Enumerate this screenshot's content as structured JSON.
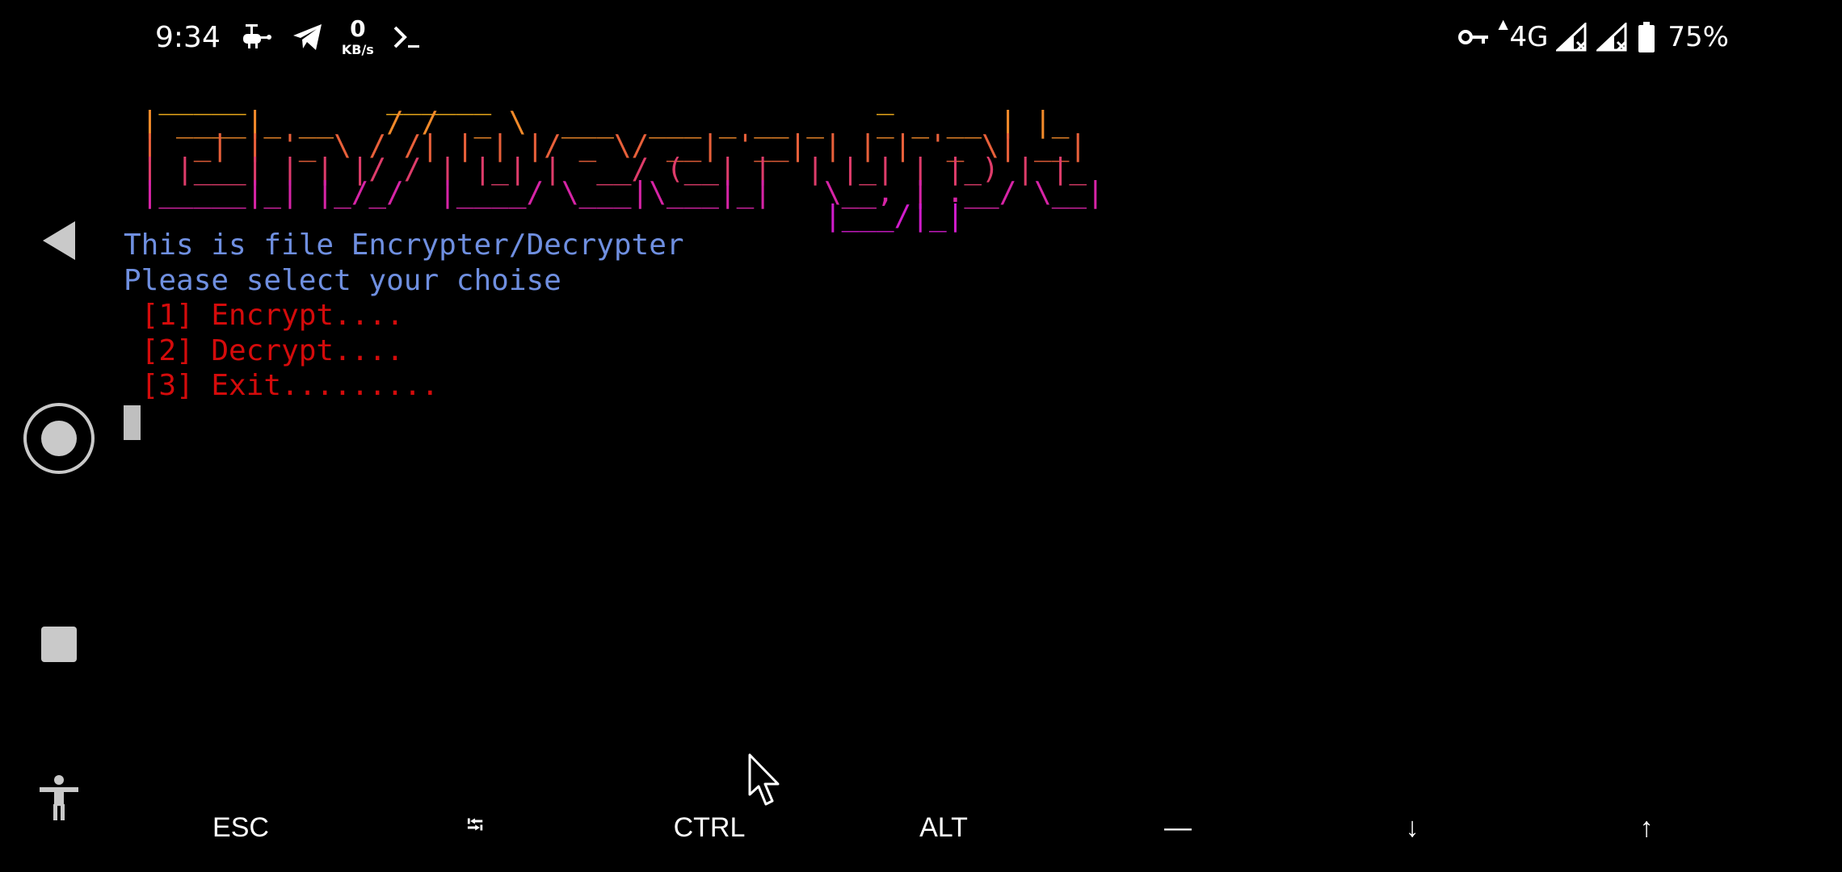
{
  "status_bar": {
    "time": "9:34",
    "net_speed_value": "0",
    "net_speed_unit": "KB/s",
    "network_type": "4G",
    "battery_percent": "75%",
    "icons": [
      "drone-icon",
      "telegram-icon",
      "terminal-icon",
      "vpn-key-icon",
      "signal-icon",
      "battery-icon"
    ]
  },
  "nav_bar": {
    "icons": [
      "back-icon",
      "home-icon",
      "recents-icon",
      "accessibility-icon"
    ]
  },
  "terminal": {
    "banner_lines": [
      "  _____        ______                      _   ",
      " | ____|_ __   / /  _ \\  ___  ___ _ __ _   _ _ __ | |_ ",
      " |  _| | '_ \\ / /| | | |/ _ \\/ __| '__| | | | '_ \\| __|",
      " | |___| | | |/ / | |_| |  __/ (__| |  | |_| | |_) | |_ ",
      " |_____|_| |_/_/  |____/ \\___|\\___|_|   \\__, | .__/ \\__|",
      "                                        |___/|_|        "
    ],
    "banner_colors": [
      "#f7b21c",
      "#f28a2a",
      "#e8603a",
      "#de3c6a",
      "#d624a6",
      "#d11ccc"
    ],
    "info_line_1": "This is file Encrypter/Decrypter",
    "info_line_2": "Please select your choise",
    "menu_options": [
      " [1] Encrypt....",
      " [2] Decrypt....",
      " [3] Exit........."
    ],
    "colors": {
      "info": "#6f8fe0",
      "menu": "#d40b0b",
      "cursor": "#bfbfbf"
    }
  },
  "extra_keys": [
    "ESC",
    "⭾",
    "CTRL",
    "ALT",
    "—",
    "↓",
    "↑"
  ]
}
